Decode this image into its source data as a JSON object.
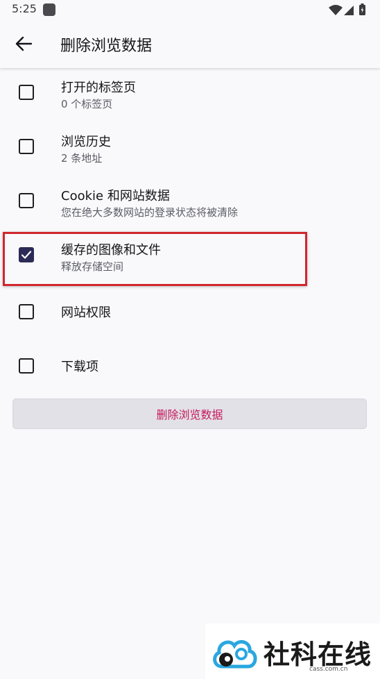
{
  "status_bar": {
    "time": "5:25",
    "icons": [
      "app-notification-icon",
      "wifi-icon",
      "signal-icon",
      "battery-charging-icon"
    ]
  },
  "app_bar": {
    "back_icon": "arrow-left-icon",
    "title": "删除浏览数据"
  },
  "options": [
    {
      "title": "打开的标签页",
      "subtitle": "0 个标签页",
      "checked": false
    },
    {
      "title": "浏览历史",
      "subtitle": "2 条地址",
      "checked": false
    },
    {
      "title": "Cookie 和网站数据",
      "subtitle": "您在绝大多数网站的登录状态将被清除",
      "checked": false
    },
    {
      "title": "缓存的图像和文件",
      "subtitle": "释放存储空间",
      "checked": true,
      "highlighted": true
    },
    {
      "title": "网站权限",
      "subtitle": "",
      "checked": false
    },
    {
      "title": "下载项",
      "subtitle": "",
      "checked": false
    }
  ],
  "delete_button": {
    "label": "删除浏览数据"
  },
  "watermark": {
    "name": "社科在线",
    "url": "cass.com.cn"
  },
  "colors": {
    "accent": "#c5195d",
    "checkbox_checked": "#2c2a56",
    "highlight": "#d0262d",
    "background": "#f9f9fb"
  }
}
